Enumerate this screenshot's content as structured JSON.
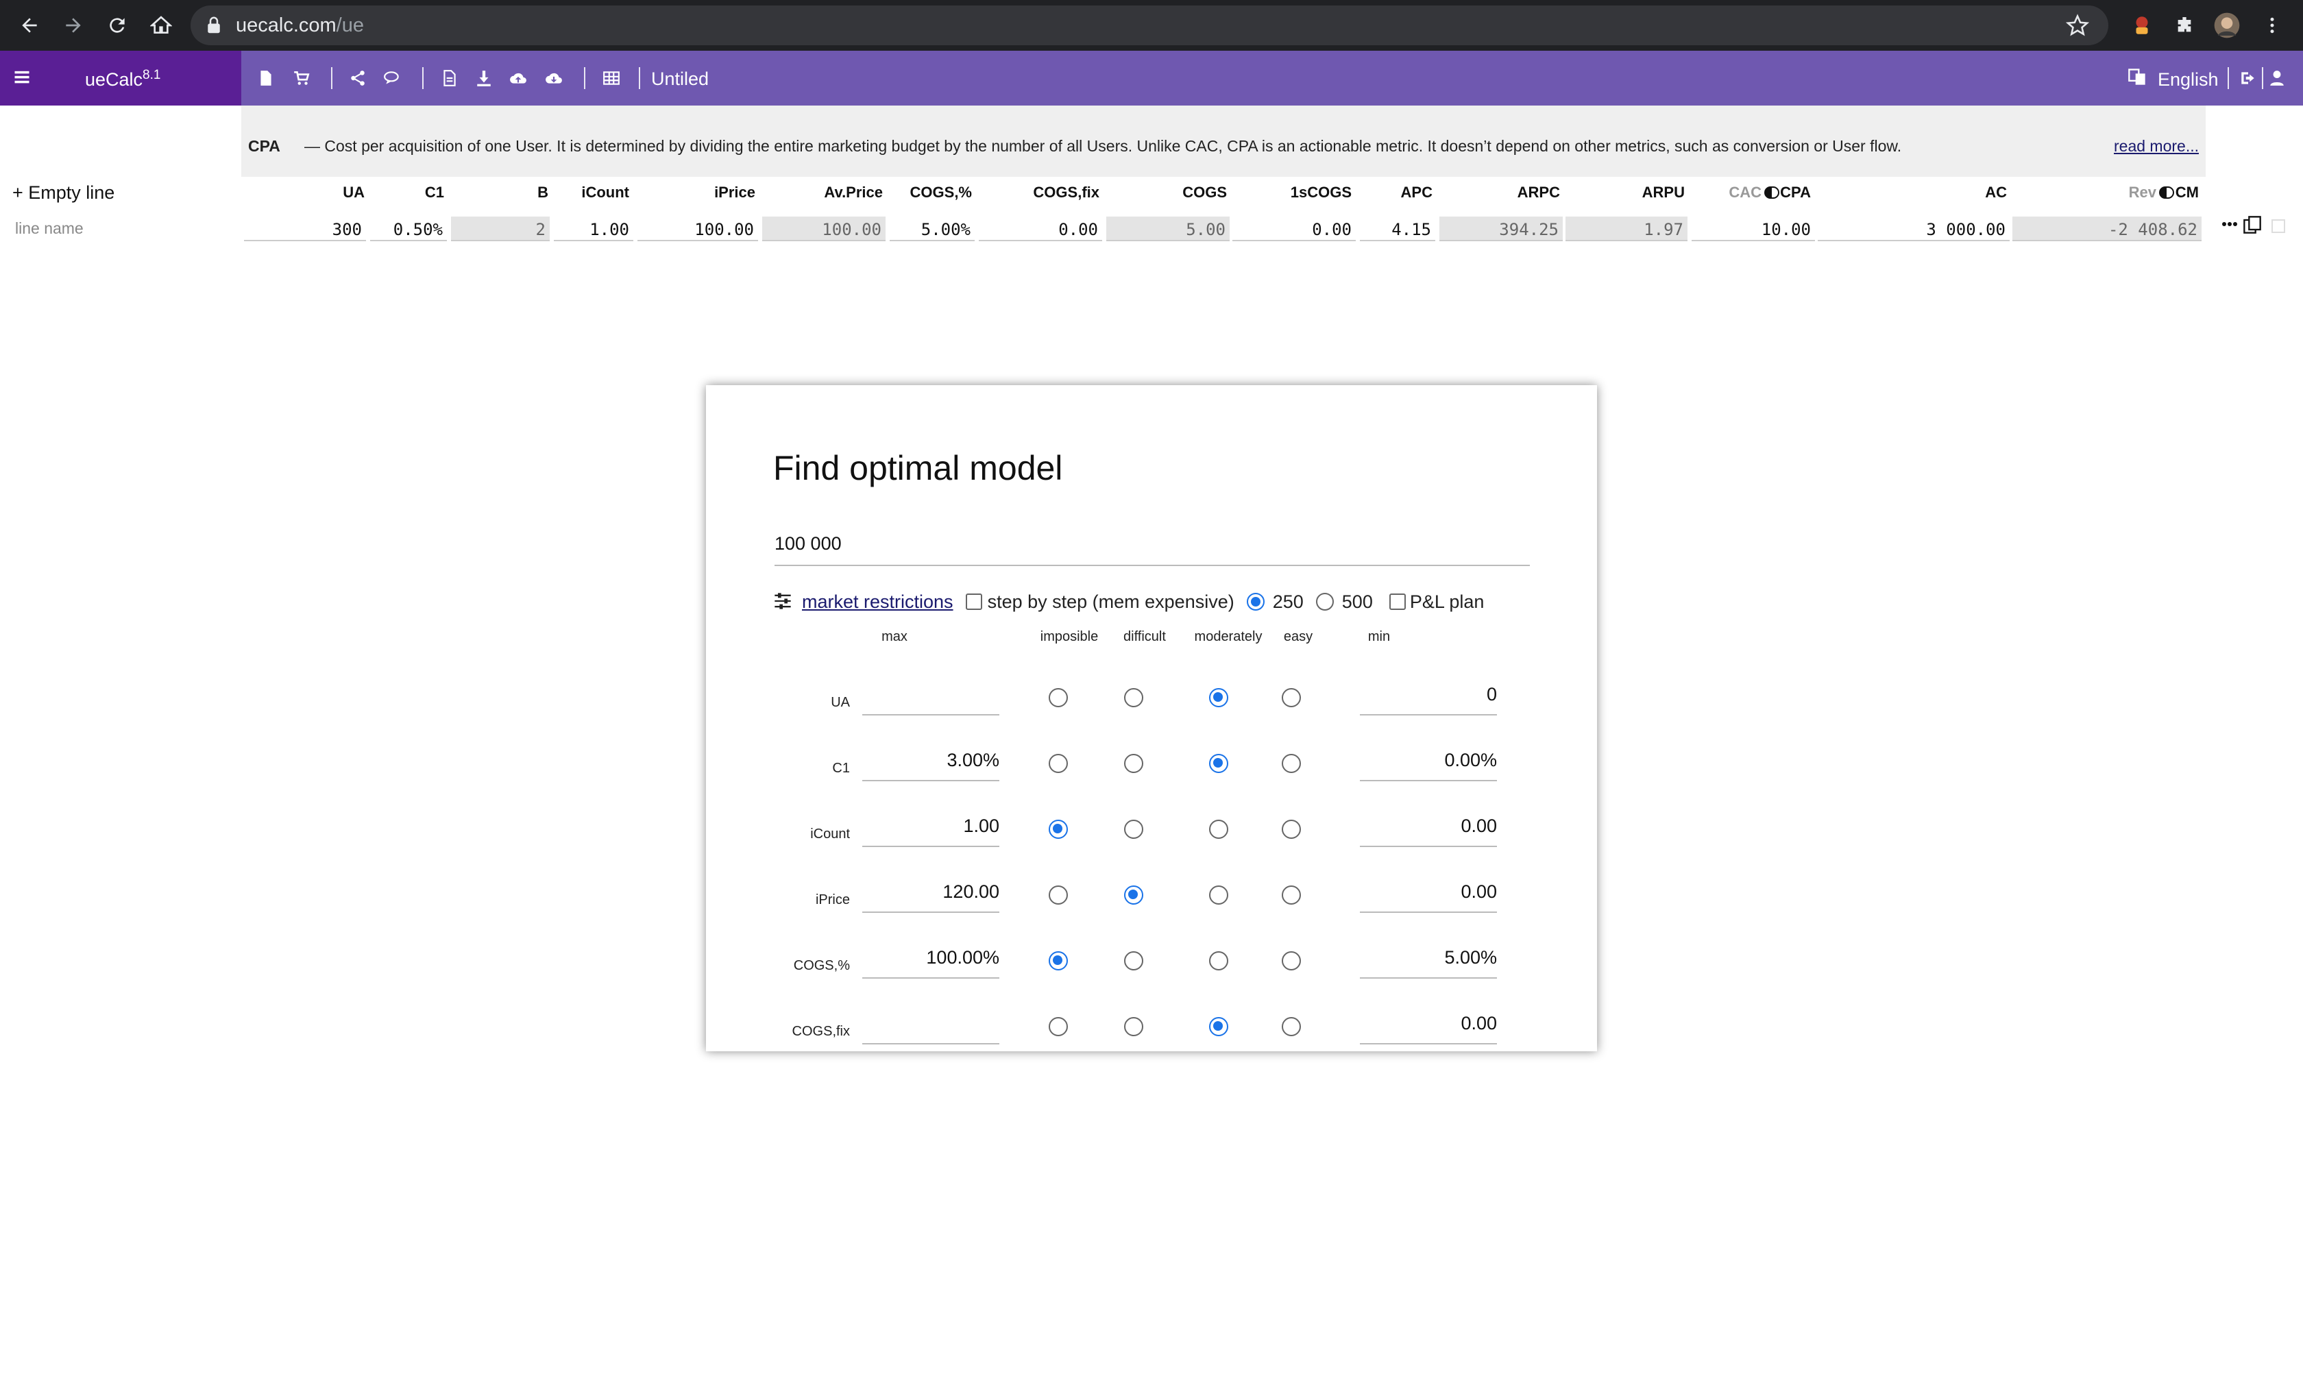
{
  "browser": {
    "url_host": "uecalc.com",
    "url_path": "/ue"
  },
  "app": {
    "brand_name": "ueCalc",
    "brand_version": "8.1",
    "document_title": "Untiled",
    "language": "English"
  },
  "info": {
    "term": "CPA",
    "text": "— Cost per acquisition of one User. It is determined by dividing the entire marketing budget by the number of all Users. Unlike CAC, CPA is an actionable metric. It doesn’t depend on other metrics, such as conversion or User flow.",
    "read_more": "read more..."
  },
  "table": {
    "add_line_label": "+ Empty line",
    "line_name_placeholder": "line name",
    "columns": [
      "UA",
      "C1",
      "B",
      "iCount",
      "iPrice",
      "Av.Price",
      "COGS,%",
      "COGS,fix",
      "COGS",
      "1sCOGS",
      "APC",
      "ARPC",
      "ARPU",
      "CAC",
      "CPA",
      "AC",
      "Rev",
      "CM"
    ],
    "values": [
      "300",
      "0.50%",
      "2",
      "1.00",
      "100.00",
      "100.00",
      "5.00%",
      "0.00",
      "5.00",
      "0.00",
      "4.15",
      "394.25",
      "1.97",
      "10.00",
      "3 000.00",
      "-2 408.62"
    ]
  },
  "modal": {
    "title": "Find optimal model",
    "budget_value": "100 000",
    "market_restrictions_label": "market restrictions",
    "step_by_step_label": "step by step (mem expensive)",
    "option_250": "250",
    "option_500": "500",
    "pl_plan_label": "P&L plan",
    "col_max": "max",
    "col_impossible": "imposible",
    "col_difficult": "difficult",
    "col_moderately": "moderately",
    "col_easy": "easy",
    "col_min": "min",
    "rows": [
      {
        "label": "UA",
        "max": "",
        "min": "0",
        "selected": "moderately"
      },
      {
        "label": "C1",
        "max": "3.00%",
        "min": "0.00%",
        "selected": "moderately"
      },
      {
        "label": "iCount",
        "max": "1.00",
        "min": "0.00",
        "selected": "imposible"
      },
      {
        "label": "iPrice",
        "max": "120.00",
        "min": "0.00",
        "selected": "difficult"
      },
      {
        "label": "COGS,%",
        "max": "100.00%",
        "min": "5.00%",
        "selected": "imposible"
      },
      {
        "label": "COGS,fix",
        "max": "",
        "min": "0.00",
        "selected": "moderately"
      }
    ]
  }
}
